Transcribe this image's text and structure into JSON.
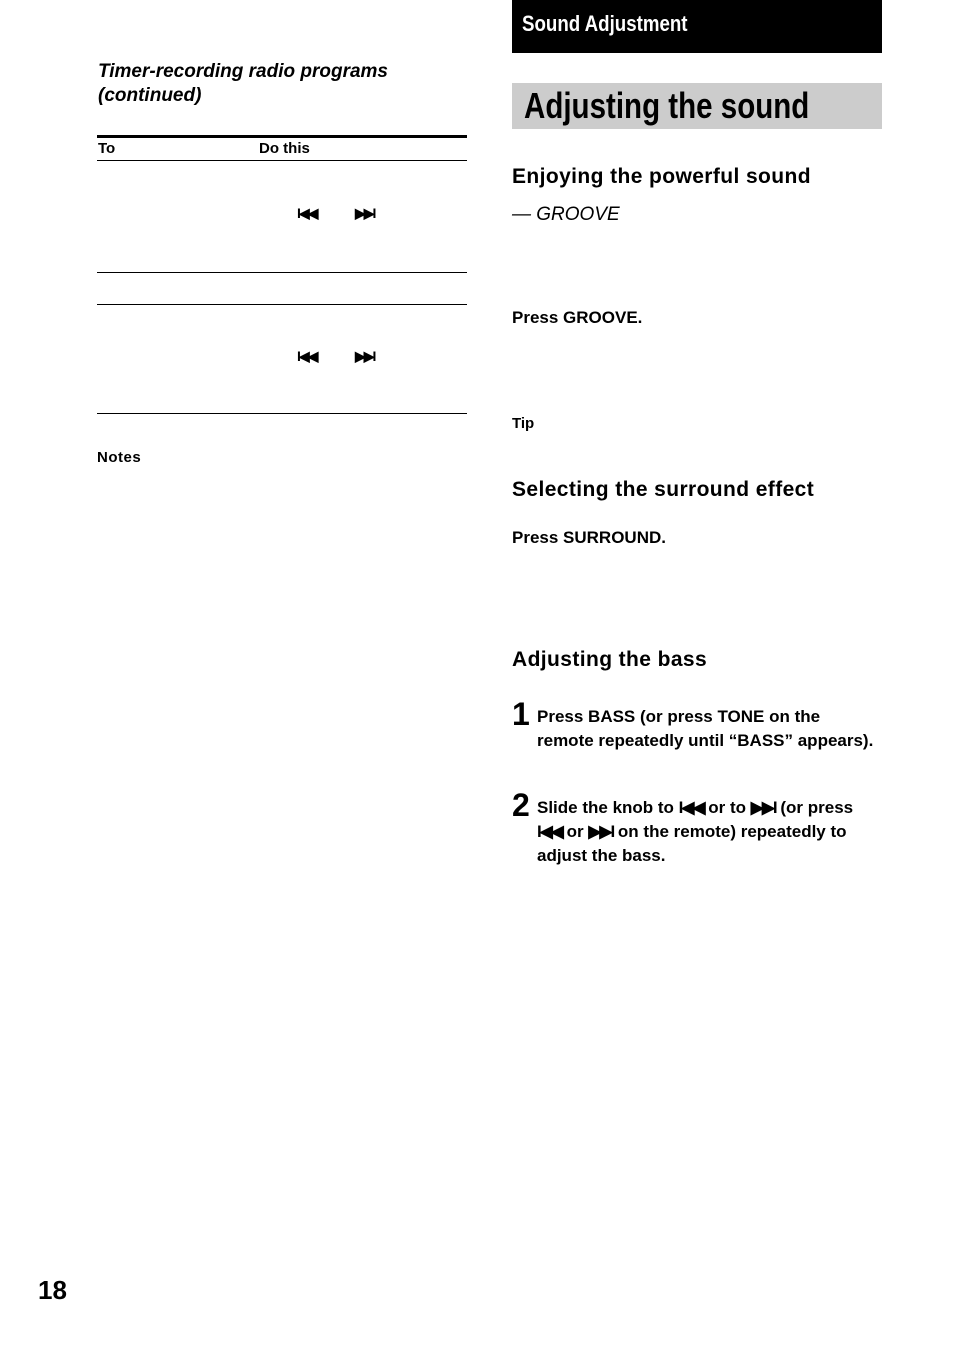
{
  "left_column": {
    "subtitle_line1": "Timer-recording radio programs",
    "subtitle_line2": "(continued)",
    "table": {
      "headers": [
        "To",
        "Do this"
      ],
      "rows": [
        {
          "icons": [
            "prev-track-icon",
            "next-track-icon"
          ],
          "prev_glyph": "I◀◀",
          "next_glyph": "▶▶I"
        },
        {
          "icons": []
        },
        {
          "icons": [
            "prev-track-icon",
            "next-track-icon"
          ],
          "prev_glyph": "I◀◀",
          "next_glyph": "▶▶I"
        }
      ]
    },
    "notes_label": "Notes"
  },
  "right_column": {
    "section_label": "Sound Adjustment",
    "page_title": "Adjusting the sound",
    "groove_heading": "Enjoying the powerful sound",
    "groove_subheading": "— GROOVE",
    "groove_instruction": "Press GROOVE.",
    "tip_label": "Tip",
    "surround_heading": "Selecting the surround effect",
    "surround_instruction": "Press SURROUND.",
    "bass_heading": "Adjusting the bass",
    "steps": [
      {
        "number": "1",
        "text": "Press BASS (or press TONE on the remote repeatedly until “BASS” appears)."
      },
      {
        "number": "2",
        "text_parts": [
          "Slide the knob to ",
          "I◀◀",
          " or to ",
          "▶▶I",
          " (or press ",
          "I◀◀",
          " or ",
          "▶▶I",
          " on the remote) repeatedly to adjust the bass."
        ]
      }
    ]
  },
  "page_number": "18"
}
